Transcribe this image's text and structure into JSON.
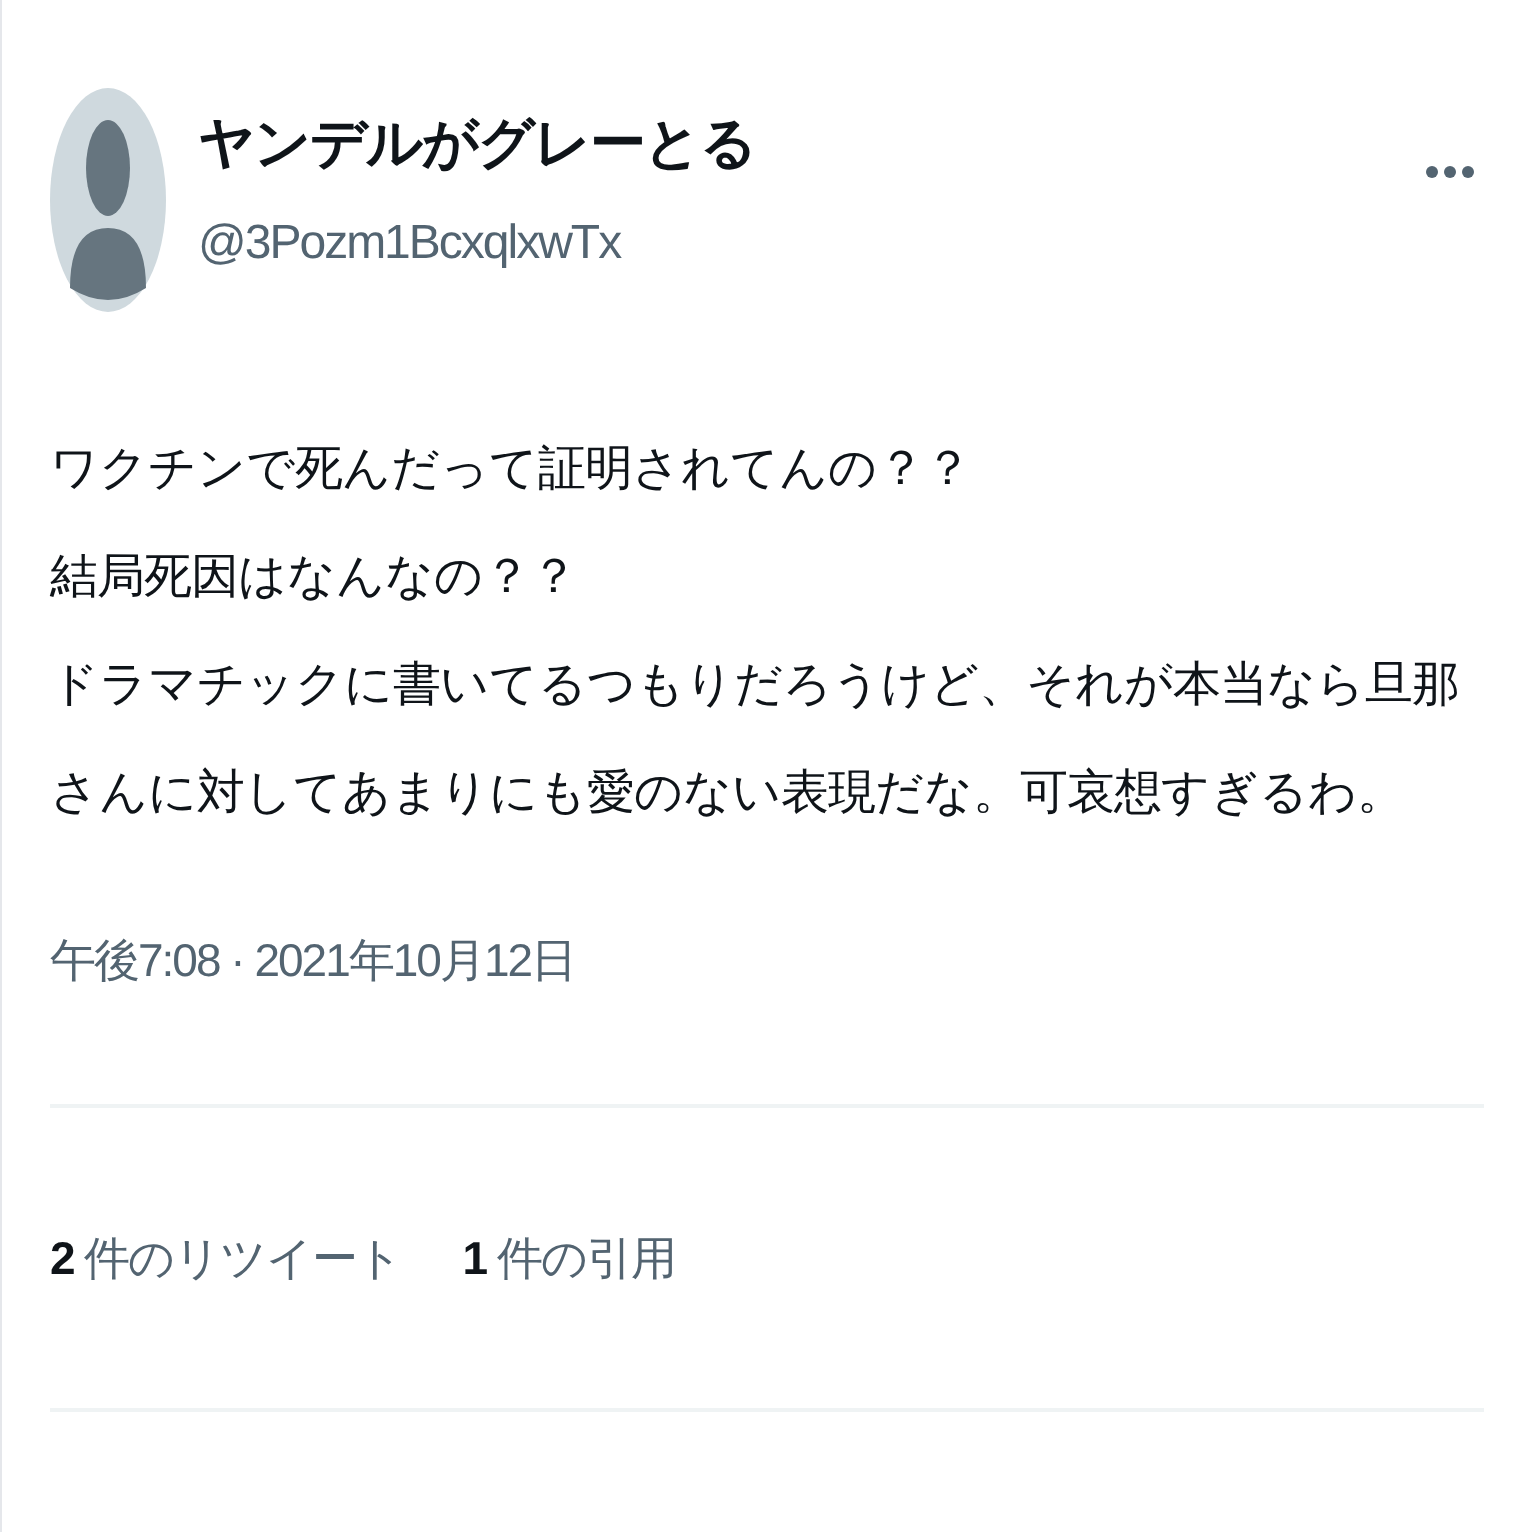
{
  "author": {
    "name": "ヤンデルがグレーとる",
    "handle": "@3Pozm1BcxqlxwTx"
  },
  "body": [
    "ワクチンで死んだって証明されてんの？？",
    "結局死因はなんなの？？",
    "ドラマチックに書いてるつもりだろうけど、それが本当なら旦那",
    "さんに対してあまりにも愛のない表現だな。可哀想すぎるわ。"
  ],
  "timestamp": "午後7:08 · 2021年10月12日",
  "stats": [
    {
      "count": "2",
      "label": "件のリツイート"
    },
    {
      "count": "1",
      "label": "件の引用"
    }
  ]
}
